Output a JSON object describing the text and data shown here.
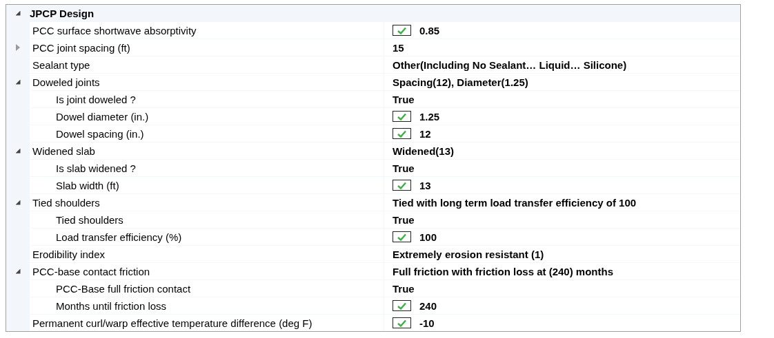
{
  "grid": {
    "category": {
      "label": "JPCP Design",
      "expanded": true
    },
    "properties": [
      {
        "label": "PCC surface shortwave absorptivity",
        "value": "0.85",
        "checked": true
      },
      {
        "label": "PCC joint spacing (ft)",
        "value": "15",
        "expanded": false
      },
      {
        "label": "Sealant type",
        "value": "Other(Including No Sealant… Liquid… Silicone)"
      },
      {
        "label": "Doweled joints",
        "value": "Spacing(12), Diameter(1.25)",
        "expanded": true,
        "children": [
          {
            "label": "Is joint doweled ?",
            "value": "True"
          },
          {
            "label": "Dowel diameter (in.)",
            "value": "1.25",
            "checked": true
          },
          {
            "label": "Dowel spacing (in.)",
            "value": "12",
            "checked": true
          }
        ]
      },
      {
        "label": "Widened slab",
        "value": "Widened(13)",
        "expanded": true,
        "children": [
          {
            "label": "Is slab widened ?",
            "value": "True"
          },
          {
            "label": "Slab width (ft)",
            "value": "13",
            "checked": true
          }
        ]
      },
      {
        "label": "Tied shoulders",
        "value": "Tied with long term load transfer efficiency of 100",
        "expanded": true,
        "children": [
          {
            "label": "Tied shoulders",
            "value": "True"
          },
          {
            "label": "Load transfer efficiency (%)",
            "value": "100",
            "checked": true
          }
        ]
      },
      {
        "label": "Erodibility index",
        "value": "Extremely erosion resistant (1)"
      },
      {
        "label": "PCC-base contact friction",
        "value": "Full friction with friction loss at (240) months",
        "expanded": true,
        "children": [
          {
            "label": "PCC-Base full friction contact",
            "value": "True"
          },
          {
            "label": "Months until friction loss",
            "value": "240",
            "checked": true
          }
        ]
      },
      {
        "label": "Permanent curl/warp effective temperature difference (deg F)",
        "value": "-10",
        "checked": true
      }
    ]
  }
}
